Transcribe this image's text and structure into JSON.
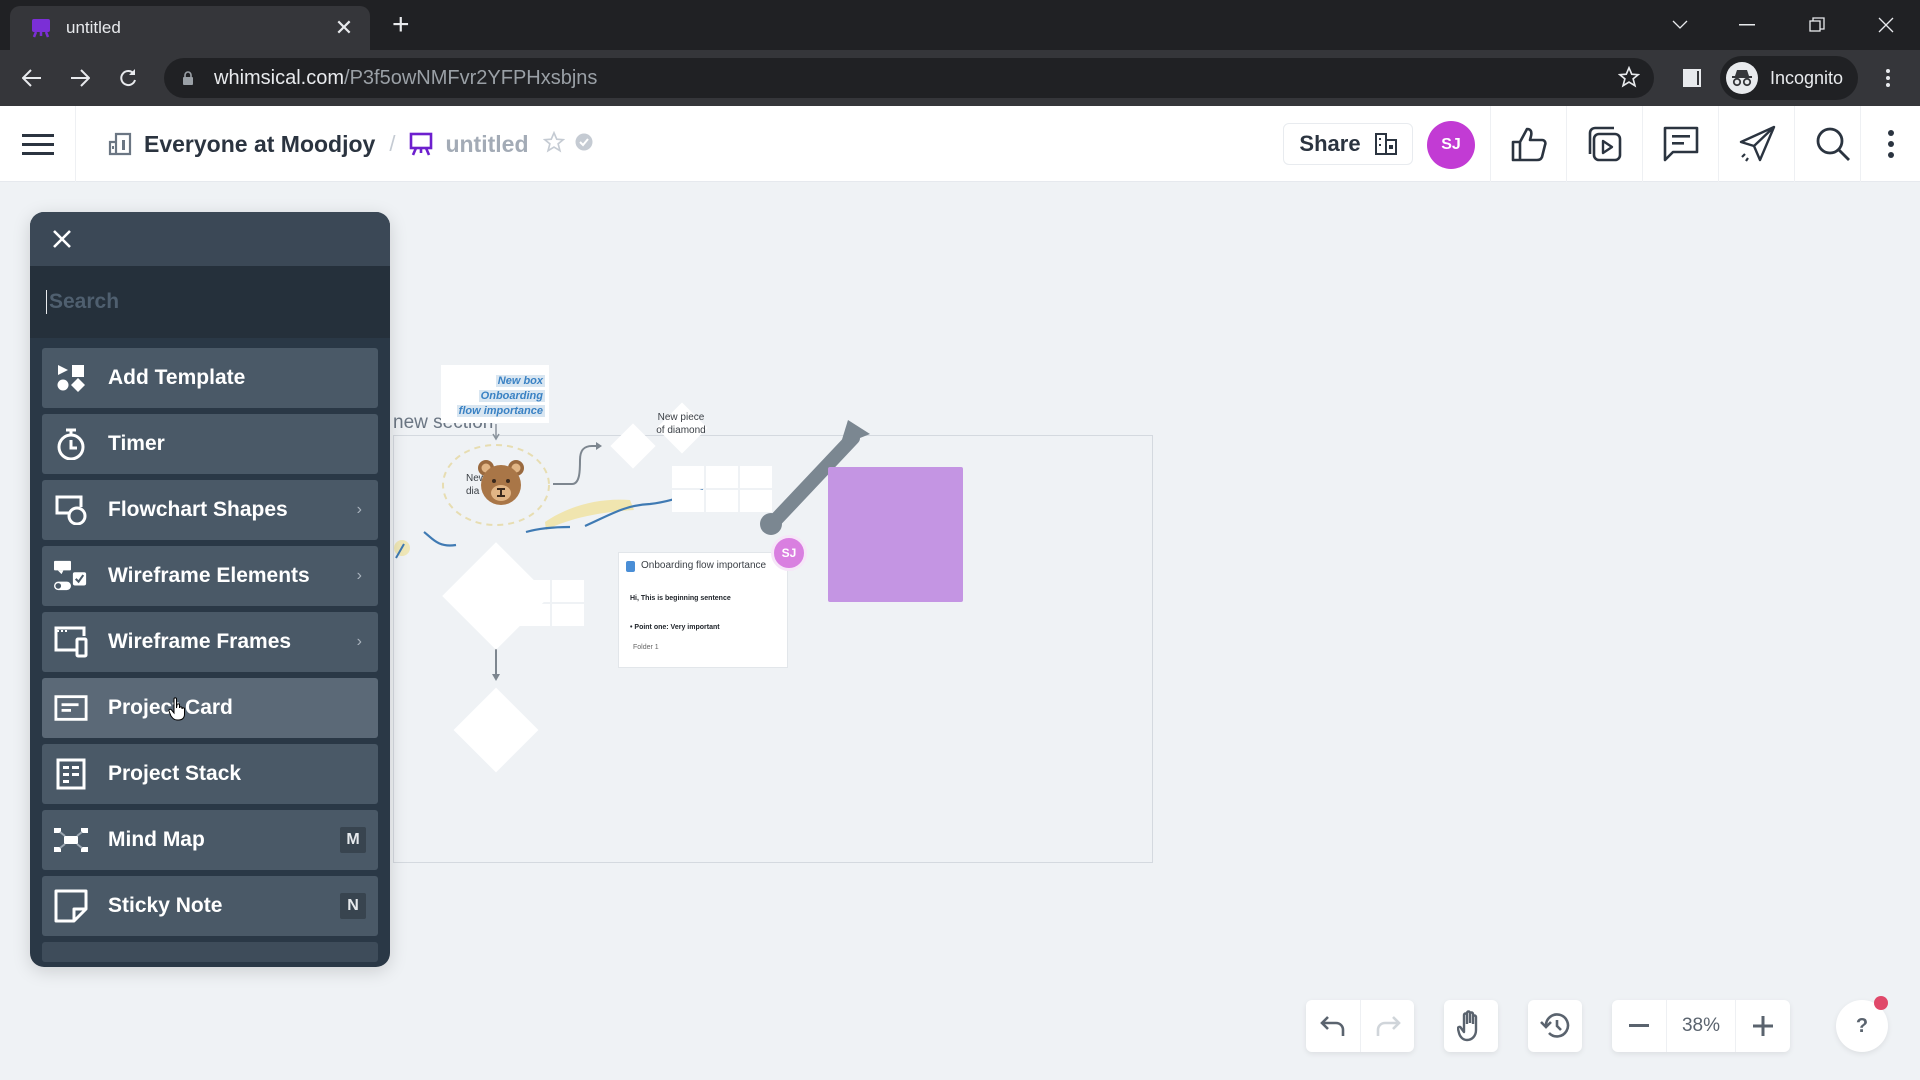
{
  "browser": {
    "tab_title": "untitled",
    "url_host": "whimsical.com",
    "url_path": "/P3f5owNMFvr2YFPHxsbjns",
    "profile_label": "Incognito"
  },
  "header": {
    "team_name": "Everyone at Moodjoy",
    "separator": "/",
    "doc_title": "untitled",
    "share_label": "Share",
    "user_initials": "SJ",
    "avatar_color": "#c23bd4"
  },
  "panel": {
    "search_placeholder": "Search",
    "items": [
      {
        "label": "Add Template",
        "icon": "template-icon"
      },
      {
        "label": "Timer",
        "icon": "timer-icon"
      },
      {
        "label": "Flowchart Shapes",
        "icon": "flowchart-shapes-icon",
        "chevron": "›"
      },
      {
        "label": "Wireframe Elements",
        "icon": "wireframe-elements-icon",
        "chevron": "›"
      },
      {
        "label": "Wireframe Frames",
        "icon": "wireframe-frames-icon",
        "chevron": "›"
      },
      {
        "label": "Project Card",
        "icon": "project-card-icon"
      },
      {
        "label": "Project Stack",
        "icon": "project-stack-icon"
      },
      {
        "label": "Mind Map",
        "icon": "mind-map-icon",
        "shortcut": "M"
      },
      {
        "label": "Sticky Note",
        "icon": "sticky-note-icon",
        "shortcut": "N"
      }
    ]
  },
  "canvas": {
    "section_title": "new section",
    "note_lines": [
      "New box",
      "Onboarding",
      "flow importance"
    ],
    "diamond_label_1": "New piece of diamond",
    "diamond_label_partial": "New dia",
    "doc_card": {
      "title": "Onboarding flow importance",
      "line_1": "Hi, This is beginning sentence",
      "line_2": "• Point one: Very important",
      "folder": "Folder 1"
    },
    "collaborator_initials": "SJ",
    "sticky_color": "#c495e3"
  },
  "controls": {
    "zoom_level": "38%",
    "help_label": "?"
  }
}
